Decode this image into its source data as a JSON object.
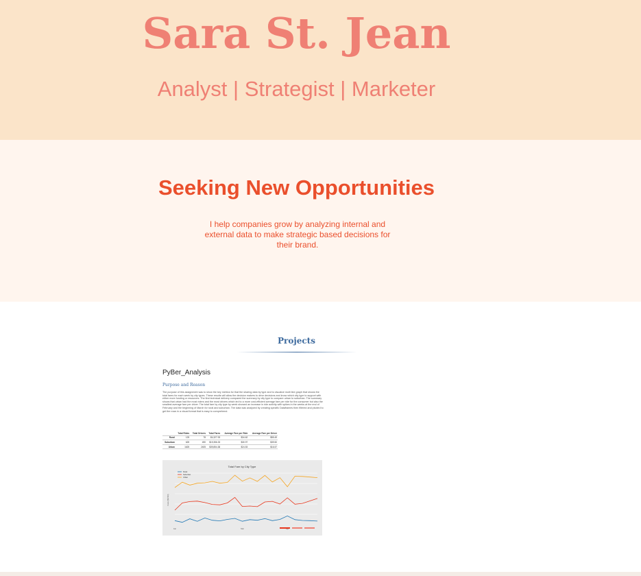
{
  "hero": {
    "name": "Sara St. Jean",
    "subtitle": "Analyst | Strategist | Marketer"
  },
  "intro": {
    "title": "Seeking New Opportunities",
    "text": "I help companies grow by analyzing internal and external data to make strategic based decisions for their brand."
  },
  "projects": {
    "title": "Projects",
    "card": {
      "title": "PyBer_Analysis",
      "subtitle": "Purpose and Reason",
      "paragraph": "The purpose of this assignment was to show the key metrics for that the sharing data by type and to visualize multi line graph that shows the total fares for each week by city types. These results will allow the decision makers to drive decisions and know which city type to support with either more funding or resources. The first technical delivery compared the summary by city type to compare urban to suburban. The summary shows that urban had the most riders and the most drivers which led to a more cost-efficient average fare per ride for the consumer but also the smallest average fare per driver. The total fare by city type by week showed an increase in ride activity with spikes in the weeks at the end of February and the beginning of March for rural and suburban. The data was analyzed by creating specific Dataframes then filtered and pivoted to get the rows in a visual format that is easy to comprehend.",
      "table": {
        "headers": [
          "",
          "Total Rides",
          "Total Drivers",
          "Total Fares",
          "Average Fare per Ride",
          "Average Fare per Driver"
        ],
        "rows": [
          [
            "Rural",
            "125",
            "78",
            "$4,327.93",
            "$34.62",
            "$55.49"
          ],
          [
            "Suburban",
            "625",
            "490",
            "$19,356.33",
            "$30.97",
            "$39.50"
          ],
          [
            "Urban",
            "1625",
            "2405",
            "$39,854.38",
            "$24.53",
            "$16.57"
          ]
        ]
      },
      "chart_data": {
        "type": "line",
        "title": "Total Fare by City Type",
        "xlabel": "",
        "ylabel": "Fare ($USD)",
        "x": [
          "Jan",
          "",
          "",
          "",
          "",
          "",
          "",
          "",
          "",
          "Mar",
          "",
          "",
          "",
          "",
          "",
          "Apr",
          "",
          "",
          "",
          ""
        ],
        "series": [
          {
            "name": "Rural",
            "color": "#1f77b4",
            "values": [
              190,
              110,
              280,
              160,
              320,
              210,
              180,
              250,
              300,
              160,
              240,
              210,
              290,
              190,
              250,
              420,
              240,
              200,
              190,
              170
            ]
          },
          {
            "name": "Suburban",
            "color": "#e8361c",
            "values": [
              700,
              1050,
              1120,
              1140,
              1070,
              980,
              960,
              1050,
              1320,
              880,
              900,
              870,
              1100,
              1130,
              1000,
              1300,
              990,
              1030,
              1150,
              1270
            ]
          },
          {
            "name": "Urban",
            "color": "#f5a623",
            "values": [
              1800,
              2060,
              1920,
              2010,
              2030,
              2100,
              2010,
              2050,
              2400,
              2110,
              2270,
              2100,
              2390,
              2070,
              2280,
              1840,
              2350,
              2340,
              2310,
              2280
            ]
          }
        ],
        "ylim": [
          0,
          2600
        ],
        "legend": "top-left"
      }
    }
  }
}
